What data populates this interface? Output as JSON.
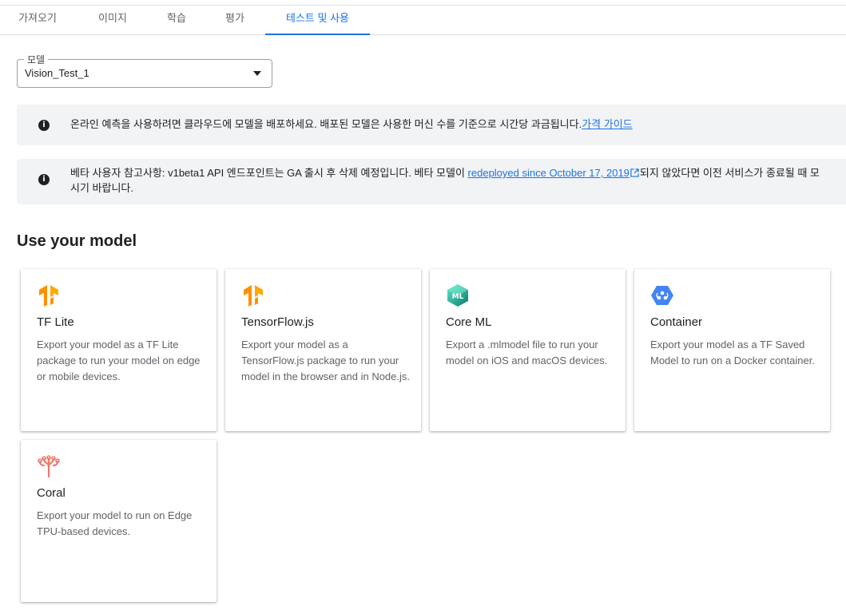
{
  "tabs": [
    {
      "label": "가져오기"
    },
    {
      "label": "이미지"
    },
    {
      "label": "학습"
    },
    {
      "label": "평가"
    },
    {
      "label": "테스트 및 사용"
    }
  ],
  "model_select": {
    "label": "모델",
    "value": "Vision_Test_1"
  },
  "banner1": {
    "text": "온라인 예측을 사용하려면 클라우드에 모델을 배포하세요. 배포된 모델은 사용한 머신 수를 기준으로 시간당 과금됩니다.",
    "link": "가격 가이드"
  },
  "banner2": {
    "text_before": "베타 사용자 참고사항: v1beta1 API 엔드포인트는 GA 출시 후 삭제 예정입니다. 베타 모델이 ",
    "link": "redeployed since October 17, 2019",
    "text_after": "되지 않았다면 이전 서비스가 종료될 때 모",
    "line2": "시기 바랍니다."
  },
  "section_title": "Use your model",
  "cards": [
    {
      "title": "TF Lite",
      "desc": "Export your model as a TF Lite package to run your model on edge or mobile devices.",
      "icon": "tensorflow-icon"
    },
    {
      "title": "TensorFlow.js",
      "desc": "Export your model as a TensorFlow.js package to run your model in the browser and in Node.js.",
      "icon": "tensorflow-icon"
    },
    {
      "title": "Core ML",
      "desc": "Export a .mlmodel file to run your model on iOS and macOS devices.",
      "icon": "coreml-icon"
    },
    {
      "title": "Container",
      "desc": "Export your model as a TF Saved Model to run on a Docker container.",
      "icon": "container-icon"
    },
    {
      "title": "Coral",
      "desc": "Export your model to run on Edge TPU-based devices.",
      "icon": "coral-icon"
    }
  ],
  "colors": {
    "accent": "#1a73e8",
    "banner_bg": "#f1f3f4",
    "tensorflow_orange": "#ff8f00",
    "coral": "#f0776b"
  }
}
